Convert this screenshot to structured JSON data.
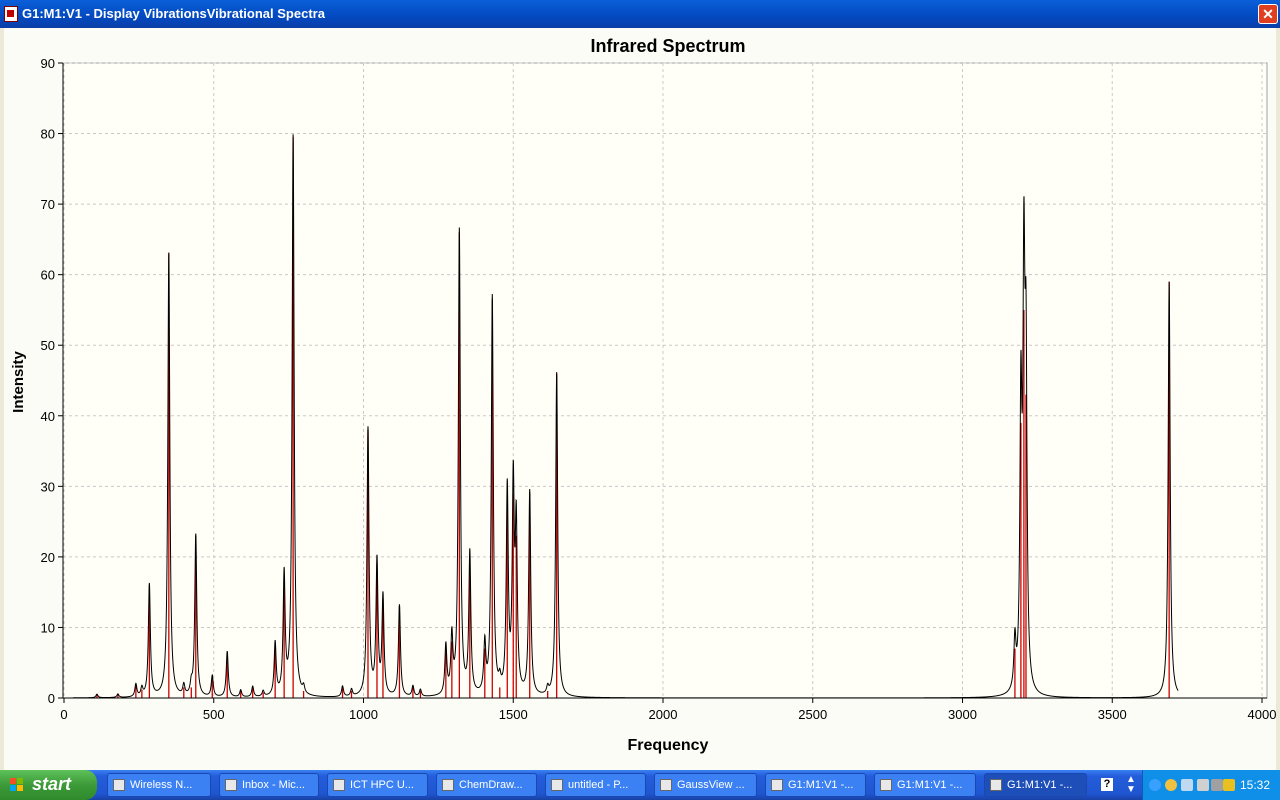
{
  "window": {
    "title": "G1:M1:V1 - Display VibrationsVibrational Spectra",
    "close_glyph": "✕"
  },
  "chart_data": {
    "type": "line",
    "title": "Infrared Spectrum",
    "xlabel": "Frequency",
    "ylabel": "Intensity",
    "xlim": [
      0,
      4000
    ],
    "ylim": [
      0,
      90
    ],
    "xticks": [
      0,
      500,
      1000,
      1500,
      2000,
      2500,
      3000,
      3500,
      4000
    ],
    "yticks": [
      0,
      10,
      20,
      30,
      40,
      50,
      60,
      70,
      80,
      90
    ],
    "grid": true,
    "spectrum_color": "#000000",
    "stick_color": "#cc0000",
    "line_width_cm": 4,
    "sticks": [
      {
        "x": 110,
        "y": 0.5
      },
      {
        "x": 180,
        "y": 0.5
      },
      {
        "x": 240,
        "y": 1.8
      },
      {
        "x": 260,
        "y": 1.2
      },
      {
        "x": 285,
        "y": 16
      },
      {
        "x": 350,
        "y": 63
      },
      {
        "x": 400,
        "y": 1.5
      },
      {
        "x": 425,
        "y": 1.5
      },
      {
        "x": 440,
        "y": 23
      },
      {
        "x": 495,
        "y": 3
      },
      {
        "x": 545,
        "y": 6.5
      },
      {
        "x": 590,
        "y": 1
      },
      {
        "x": 630,
        "y": 1.5
      },
      {
        "x": 665,
        "y": 0.8
      },
      {
        "x": 705,
        "y": 7.5
      },
      {
        "x": 735,
        "y": 17
      },
      {
        "x": 765,
        "y": 79.5
      },
      {
        "x": 800,
        "y": 1
      },
      {
        "x": 930,
        "y": 1.5
      },
      {
        "x": 960,
        "y": 1
      },
      {
        "x": 1015,
        "y": 38
      },
      {
        "x": 1045,
        "y": 19
      },
      {
        "x": 1065,
        "y": 14
      },
      {
        "x": 1120,
        "y": 13
      },
      {
        "x": 1165,
        "y": 1.5
      },
      {
        "x": 1190,
        "y": 1
      },
      {
        "x": 1275,
        "y": 7
      },
      {
        "x": 1295,
        "y": 8
      },
      {
        "x": 1320,
        "y": 66
      },
      {
        "x": 1355,
        "y": 20
      },
      {
        "x": 1405,
        "y": 7
      },
      {
        "x": 1430,
        "y": 56.5
      },
      {
        "x": 1455,
        "y": 1.5
      },
      {
        "x": 1480,
        "y": 29
      },
      {
        "x": 1500,
        "y": 29
      },
      {
        "x": 1510,
        "y": 23
      },
      {
        "x": 1555,
        "y": 29
      },
      {
        "x": 1615,
        "y": 1
      },
      {
        "x": 1645,
        "y": 46
      },
      {
        "x": 3175,
        "y": 7
      },
      {
        "x": 3195,
        "y": 39
      },
      {
        "x": 3205,
        "y": 55
      },
      {
        "x": 3212,
        "y": 43
      },
      {
        "x": 3690,
        "y": 59
      }
    ]
  },
  "taskbar": {
    "start_label": "start",
    "tasks": [
      {
        "label": "Wireless N...",
        "icon": "wireless-icon"
      },
      {
        "label": "Inbox - Mic...",
        "icon": "outlook-icon"
      },
      {
        "label": "ICT HPC U...",
        "icon": "ie-icon"
      },
      {
        "label": "ChemDraw...",
        "icon": "chemdraw-icon"
      },
      {
        "label": "untitled - P...",
        "icon": "paint-icon"
      },
      {
        "label": "GaussView ...",
        "icon": "gaussview-icon"
      },
      {
        "label": "G1:M1:V1 -...",
        "icon": "gaussview-doc-icon"
      },
      {
        "label": "G1:M1:V1 -...",
        "icon": "gaussview-doc-icon"
      },
      {
        "label": "G1:M1:V1 -...",
        "icon": "gaussview-doc-icon",
        "active": true
      }
    ],
    "help_glyph": "?",
    "clock": "15:32"
  }
}
